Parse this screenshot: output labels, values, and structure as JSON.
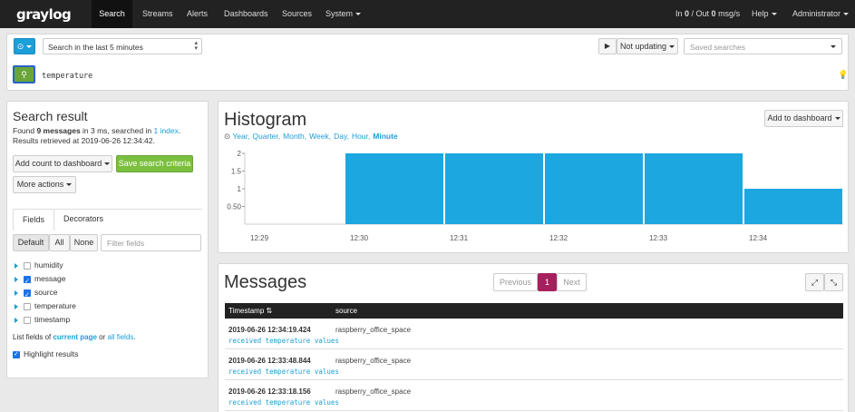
{
  "nav": {
    "logo_text": "graylog",
    "items": [
      "Search",
      "Streams",
      "Alerts",
      "Dashboards",
      "Sources",
      "System"
    ],
    "throughput_prefix": "In ",
    "throughput_in": "0",
    "throughput_mid": " / Out ",
    "throughput_out": "0",
    "throughput_suffix": " msg/s",
    "help": "Help",
    "user": "Administrator"
  },
  "search": {
    "timerange": "Search in the last 5 minutes",
    "refresh_label": "Not updating",
    "saved_searches_placeholder": "Saved searches",
    "query": "temperature"
  },
  "result": {
    "title": "Search result",
    "found_prefix": "Found ",
    "found_count": "9 messages",
    "found_middle": " in 3 ms, searched in ",
    "index_link": "1 index",
    "found_suffix": ".",
    "retrieved": "Results retrieved at 2019-06-26 12:34:42.",
    "add_count_btn": "Add count to dashboard",
    "save_btn": "Save search criteria",
    "more_actions": "More actions",
    "tabs": [
      "Fields",
      "Decorators"
    ],
    "filter_buttons": [
      "Default",
      "All",
      "None"
    ],
    "filter_placeholder": "Filter fields",
    "fields": [
      {
        "name": "humidity",
        "checked": false
      },
      {
        "name": "message",
        "checked": true
      },
      {
        "name": "source",
        "checked": true
      },
      {
        "name": "temperature",
        "checked": false
      },
      {
        "name": "timestamp",
        "checked": false
      }
    ],
    "list_fields_prefix": "List fields of ",
    "current_page": "current page",
    "list_fields_middle": " or ",
    "all_fields": "all fields",
    "list_fields_suffix": ".",
    "highlight": "Highlight results"
  },
  "histogram": {
    "title": "Histogram",
    "add_to_dashboard": "Add to dashboard",
    "resolutions": [
      "Year,",
      "Quarter,",
      "Month,",
      "Week,",
      "Day,",
      "Hour,",
      "Minute"
    ],
    "bar_color": "#1ca7e0"
  },
  "chart_data": {
    "type": "bar",
    "title": "Histogram",
    "categories": [
      "12:29",
      "12:30",
      "12:31",
      "12:32",
      "12:33",
      "12:34"
    ],
    "values": [
      0,
      2,
      2,
      2,
      2,
      1
    ],
    "yticks": [
      "0.50",
      "1",
      "1.5",
      "2"
    ],
    "ylim": [
      0,
      2
    ],
    "grid": true
  },
  "messages": {
    "title": "Messages",
    "pagination": [
      "Previous",
      "1",
      "Next"
    ],
    "columns": [
      "Timestamp",
      "source"
    ],
    "rows": [
      {
        "timestamp": "2019-06-26 12:34:19.424",
        "source": "raspberry_office_space",
        "message": "received temperature values"
      },
      {
        "timestamp": "2019-06-26 12:33:48.844",
        "source": "raspberry_office_space",
        "message": "received temperature values"
      },
      {
        "timestamp": "2019-06-26 12:33:18.156",
        "source": "raspberry_office_space",
        "message": "received temperature values"
      }
    ]
  }
}
